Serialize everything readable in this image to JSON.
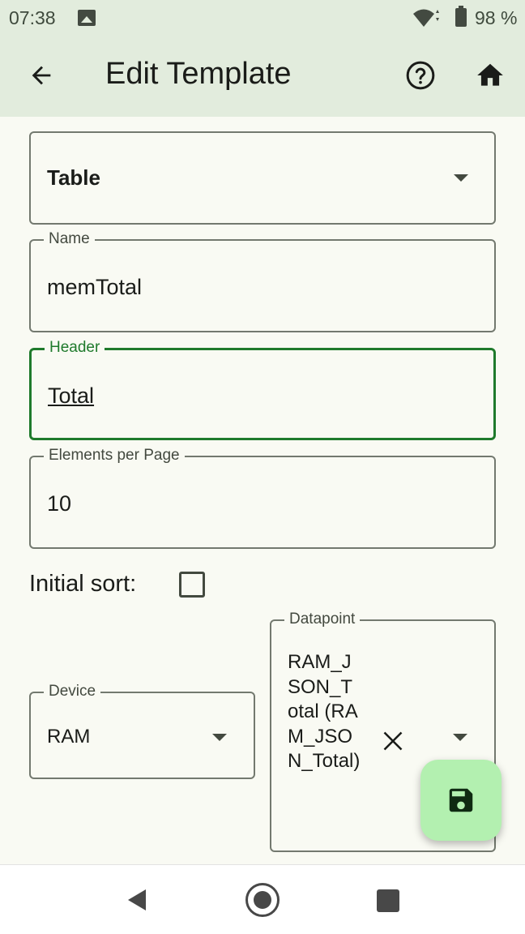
{
  "status_bar": {
    "time": "07:38",
    "battery_pct": "98 %",
    "icons": [
      "image-icon",
      "wifi-icon",
      "battery-icon"
    ]
  },
  "app_bar": {
    "title": "Edit Template",
    "icons": [
      "back-arrow-icon",
      "help-icon",
      "home-icon"
    ]
  },
  "form": {
    "type_select": {
      "value": "Table"
    },
    "name": {
      "label": "Name",
      "value": "memTotal"
    },
    "header": {
      "label": "Header",
      "value": "Total"
    },
    "elements_per_page": {
      "label": "Elements per Page",
      "value": "10"
    },
    "initial_sort": {
      "label": "Initial sort:",
      "checked": false
    },
    "device": {
      "label": "Device",
      "value": "RAM"
    },
    "datapoint": {
      "label": "Datapoint",
      "value": "RAM_JSON_Total (RAM_JSON_Total)"
    }
  },
  "fab": {
    "icon": "save-icon"
  },
  "nav_bar": {
    "icons": [
      "nav-back-icon",
      "nav-home-icon",
      "nav-recents-icon"
    ]
  },
  "colors": {
    "app_bar_bg": "#e2ecdd",
    "page_bg": "#f9faf3",
    "focus_accent": "#1f7a2c",
    "fab_bg": "#b3f0b0"
  }
}
